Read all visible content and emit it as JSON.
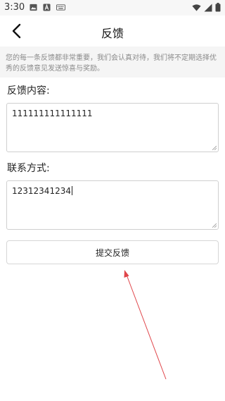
{
  "status_bar": {
    "time": "3:30",
    "icons": [
      "image-icon",
      "a-notification-icon",
      "keyboard-icon",
      "wifi-icon",
      "signal-icon",
      "battery-icon"
    ]
  },
  "nav": {
    "title": "反馈",
    "back_icon": "chevron-left-icon"
  },
  "notice": {
    "text": "您的每一条反馈都非常重要，我们会认真对待，我们将不定期选择优秀的反馈意见发送惊喜与奖励。"
  },
  "feedback": {
    "label": "反馈内容:",
    "value": "111111111111111"
  },
  "contact": {
    "label": "联系方式:",
    "value": "12312341234"
  },
  "submit": {
    "label": "提交反馈"
  },
  "colors": {
    "annotation_arrow": "#e0454a",
    "notice_bg": "#f5f5f5"
  }
}
